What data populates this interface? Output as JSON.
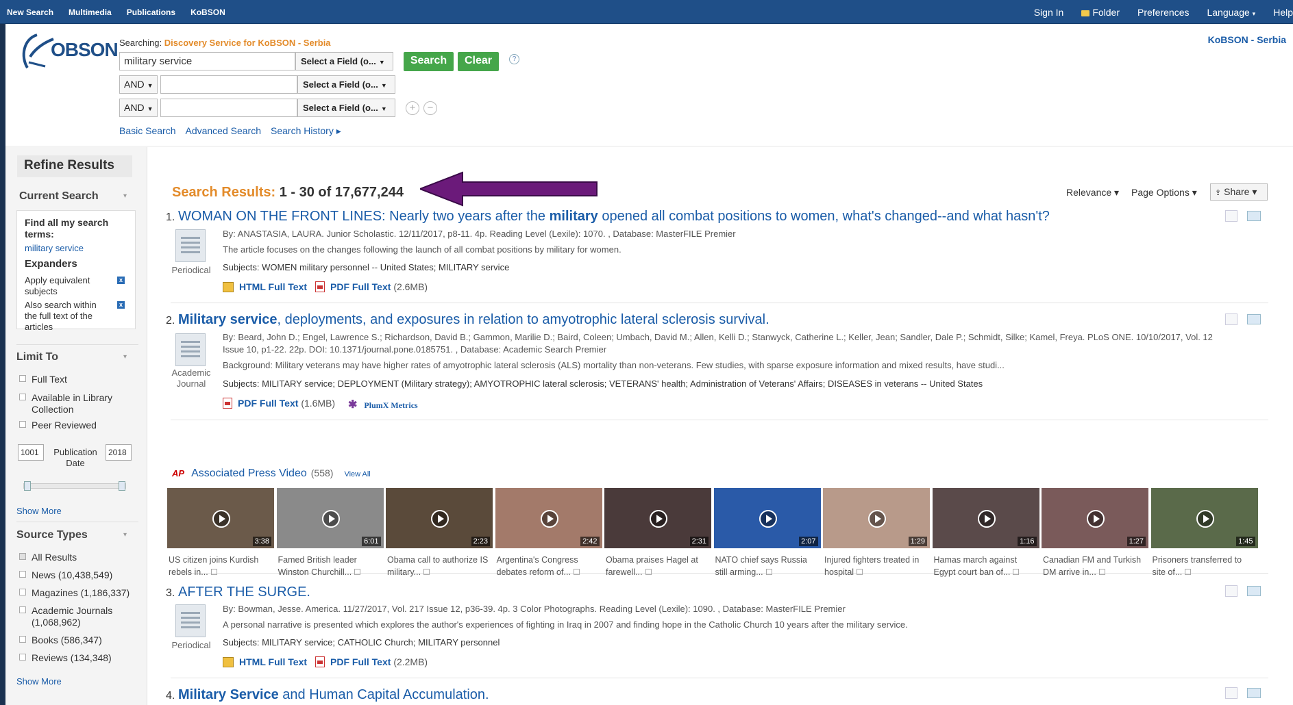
{
  "topnav": {
    "left": [
      "New Search",
      "Multimedia",
      "Publications",
      "KoBSON"
    ],
    "sign_in": "Sign In",
    "folder": "Folder",
    "preferences": "Preferences",
    "language": "Language",
    "help": "Help"
  },
  "header": {
    "logo_text": "OBSON",
    "searching_label": "Searching:",
    "database": "Discovery Service for KoBSON - Serbia",
    "query": "military service",
    "field_placeholder": "Select a Field (o...",
    "bool1": "AND",
    "bool2": "AND",
    "search_label": "Search",
    "clear_label": "Clear",
    "help_glyph": "?",
    "links": [
      "Basic Search",
      "Advanced Search",
      "Search History ▸"
    ],
    "brand": "KoBSON - Serbia"
  },
  "sidebar": {
    "title": "Refine Results",
    "current_search": "Current Search",
    "find_all": "Find all my search terms:",
    "search_terms": "military service",
    "expanders": "Expanders",
    "exp1": "Apply equivalent subjects",
    "exp2": "Also search within the full text of the articles",
    "limit_to": "Limit To",
    "full_text": "Full Text",
    "available": "Available in Library Collection",
    "peer": "Peer Reviewed",
    "year_from": "1001",
    "year_to": "2018",
    "pub_date": "Publication Date",
    "show_more": "Show More",
    "source_types": "Source Types",
    "sources": [
      "All Results",
      "News (10,438,549)",
      "Magazines (1,186,337)",
      "Academic Journals (1,068,962)",
      "Books (586,347)",
      "Reviews (134,348)"
    ],
    "show_more2": "Show More"
  },
  "results": {
    "label": "Search Results:",
    "range": "1 - 30 of 17,677,244",
    "relevance": "Relevance ▾",
    "page_options": "Page Options ▾",
    "share": "Share ▾"
  },
  "records": [
    {
      "num": "1.",
      "title_a": "WOMAN ON THE FRONT LINES: Nearly two years after the ",
      "title_b": "military",
      "title_c": " opened all combat positions to women, what's changed--and what hasn't?",
      "meta": "By: ANASTASIA, LAURA. Junior Scholastic. 12/11/2017, p8-11. 4p. Reading Level (Lexile): 1070. , Database: MasterFILE Premier",
      "abstract": "The article focuses on the changes following the launch of all combat positions by military for women.",
      "subjects": "Subjects: WOMEN military personnel -- United States; MILITARY service",
      "pubtype": "Periodical",
      "html": "HTML Full Text",
      "pdf": "PDF Full Text",
      "pdf_size": "(2.6MB)"
    },
    {
      "num": "2.",
      "title_a": "Military service",
      "title_c": ", deployments, and exposures in relation to amyotrophic lateral sclerosis survival.",
      "meta": "By: Beard, John D.; Engel, Lawrence S.; Richardson, David B.; Gammon, Marilie D.; Baird, Coleen; Umbach, David M.; Allen, Kelli D.; Stanwyck, Catherine L.; Keller, Jean; Sandler, Dale P.; Schmidt, Silke; Kamel, Freya. PLoS ONE. 10/10/2017, Vol. 12",
      "meta2": "Issue 10, p1-22. 22p. DOI: 10.1371/journal.pone.0185751. , Database: Academic Search Premier",
      "abstract": "Background: Military veterans may have higher rates of amyotrophic lateral sclerosis (ALS) mortality than non-veterans. Few studies, with sparse exposure information and mixed results, have studi...",
      "subjects": "Subjects: MILITARY service; DEPLOYMENT (Military strategy); AMYOTROPHIC lateral sclerosis; VETERANS' health; Administration of Veterans' Affairs; DISEASES in veterans -- United States",
      "pubtype": "Academic Journal",
      "pdf": "PDF Full Text",
      "pdf_size": "(1.6MB)",
      "plumx": "PlumX Metrics"
    },
    {
      "num": "3.",
      "title_a": "AFTER THE SURGE.",
      "meta": "By: Bowman, Jesse. America. 11/27/2017, Vol. 217 Issue 12, p36-39. 4p. 3 Color Photographs. Reading Level (Lexile): 1090. , Database: MasterFILE Premier",
      "abstract": "A personal narrative is presented which explores the author's experiences of fighting in Iraq in 2007 and finding hope in the Catholic Church 10 years after the military service.",
      "subjects": "Subjects: MILITARY service; CATHOLIC Church; MILITARY personnel",
      "pubtype": "Periodical",
      "html": "HTML Full Text",
      "pdf": "PDF Full Text",
      "pdf_size": "(2.2MB)"
    },
    {
      "num": "4.",
      "title_a": "Military Service",
      "title_c": " and Human Capital Accumulation."
    }
  ],
  "ap": {
    "logo": "AP",
    "title": "Associated Press Video",
    "count": "(558)",
    "view_all": "View All",
    "videos": [
      {
        "cap": "US citizen joins Kurdish rebels in...",
        "dur": "3:38",
        "color": "#6b5a4a"
      },
      {
        "cap": "Famed British leader Winston Churchill...",
        "dur": "6:01",
        "color": "#8a8a8a"
      },
      {
        "cap": "Obama call to authorize IS military...",
        "dur": "2:23",
        "color": "#5a4a3a"
      },
      {
        "cap": "Argentina's Congress debates reform of...",
        "dur": "2:42",
        "color": "#a37a6a"
      },
      {
        "cap": "Obama praises Hagel at farewell...",
        "dur": "2:31",
        "color": "#4a3a3a"
      },
      {
        "cap": "NATO chief says Russia still arming...",
        "dur": "2:07",
        "color": "#2a5aa8"
      },
      {
        "cap": "Injured fighters treated in hospital",
        "dur": "1:29",
        "color": "#b89a8a"
      },
      {
        "cap": "Hamas march against Egypt court ban of...",
        "dur": "1:16",
        "color": "#5a4a4a"
      },
      {
        "cap": "Canadian FM and Turkish DM arrive in...",
        "dur": "1:27",
        "color": "#7a5a5a"
      },
      {
        "cap": "Prisoners transferred to site of...",
        "dur": "1:45",
        "color": "#5a6a4a"
      }
    ]
  }
}
